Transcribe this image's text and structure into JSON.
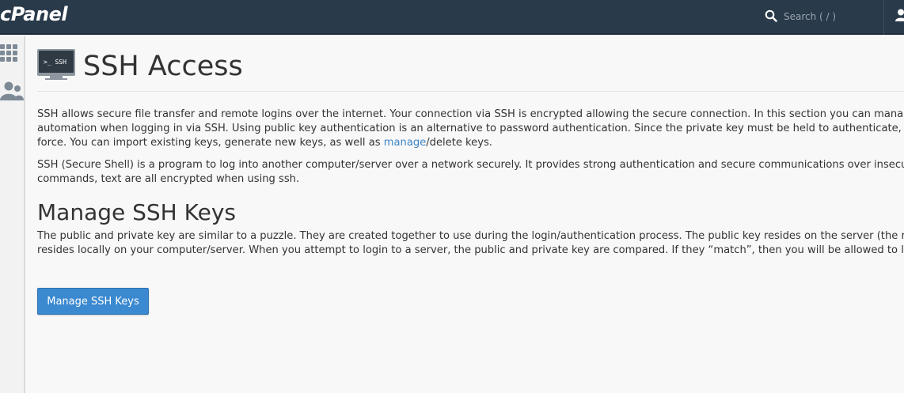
{
  "header": {
    "logo_text": "cPanel",
    "search_placeholder": "Search ( / )"
  },
  "sidebar": {
    "items": [
      {
        "icon": "grid-icon"
      },
      {
        "icon": "users-icon"
      }
    ]
  },
  "page": {
    "icon_label": ">_ SSH",
    "title": "SSH Access",
    "intro_before_link": "SSH allows secure file transfer and remote logins over the internet. Your connection via SSH is encrypted allowing the secure connection. In this section you can manage\nautomation when logging in via SSH. Using public key authentication is an alternative to password authentication. Since the private key must be held to authenticate, it is\nforce. You can import existing keys, generate new keys, as well as ",
    "intro_link": "manage",
    "intro_after_link": "/delete keys.",
    "ssh_description": "SSH (Secure Shell) is a program to log into another computer/server over a network securely. It provides strong authentication and secure communications over insecure\ncommands, text are all encrypted when using ssh.",
    "section_title": "Manage SSH Keys",
    "section_text": "The public and private key are similar to a puzzle. They are created together to use during the login/authentication process. The public key resides on the server (the rem\nresides locally on your computer/server. When you attempt to login to a server, the public and private key are compared. If they “match”, then you will be allowed to login",
    "button_label": "Manage SSH Keys"
  },
  "colors": {
    "topbar": "#293a4a",
    "link": "#3d84c6",
    "button": "#3b89d0"
  }
}
